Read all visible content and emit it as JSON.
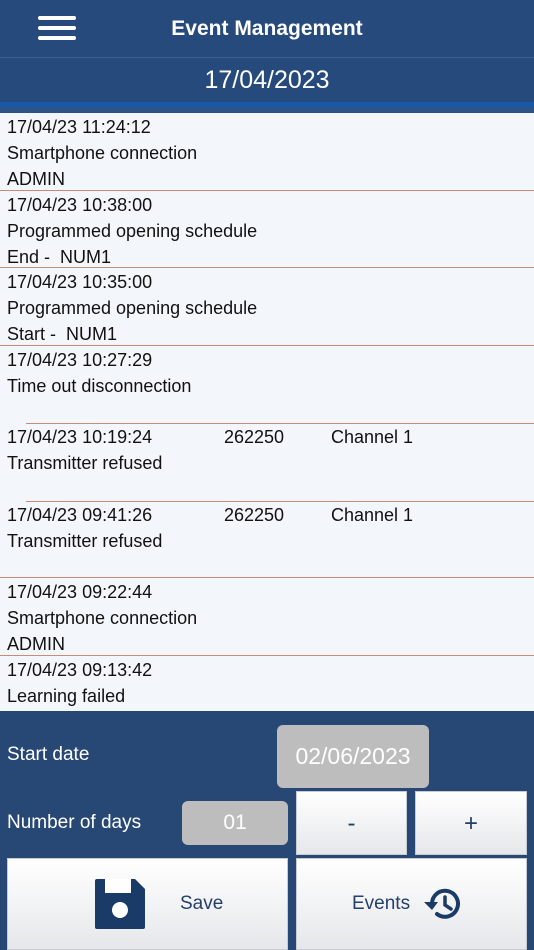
{
  "header": {
    "title": "Event Management",
    "menu_icon": "hamburger-menu-icon"
  },
  "date_bar": {
    "date": "17/04/2023"
  },
  "events": [
    {
      "line1": "17/04/23 11:24:12",
      "line2": "Smartphone connection",
      "line3": "ADMIN",
      "code": "",
      "channel": ""
    },
    {
      "line1": "17/04/23 10:38:00",
      "line2": "Programmed opening schedule",
      "line3": "End -  NUM1",
      "code": "",
      "channel": ""
    },
    {
      "line1": "17/04/23 10:35:00",
      "line2": "Programmed opening schedule",
      "line3": "Start -  NUM1",
      "code": "",
      "channel": ""
    },
    {
      "line1": "17/04/23 10:27:29",
      "line2": "Time out disconnection",
      "line3": "",
      "code": "",
      "channel": ""
    },
    {
      "line1": "17/04/23 10:19:24",
      "line2": "Transmitter refused",
      "line3": "",
      "code": "262250",
      "channel": "Channel 1"
    },
    {
      "line1": "17/04/23 09:41:26",
      "line2": "Transmitter refused",
      "line3": "",
      "code": "262250",
      "channel": "Channel 1"
    },
    {
      "line1": "17/04/23 09:22:44",
      "line2": "Smartphone connection",
      "line3": "ADMIN",
      "code": "",
      "channel": ""
    },
    {
      "line1": "17/04/23 09:13:42",
      "line2": "Learning failed",
      "line3": "",
      "code": "",
      "channel": ""
    }
  ],
  "controls": {
    "start_date_label": "Start date",
    "start_date_value": "02/06/2023",
    "days_label": "Number of days",
    "days_value": "01",
    "minus_label": "-",
    "plus_label": "+",
    "save_label": "Save",
    "events_label": "Events"
  },
  "colors": {
    "header_bg": "#264a7c",
    "accent": "#1958a8",
    "list_bg": "#f3f7fc",
    "separator": "#c98a7a",
    "field_bg": "#bdbdbd",
    "button_text": "#243f6a"
  }
}
